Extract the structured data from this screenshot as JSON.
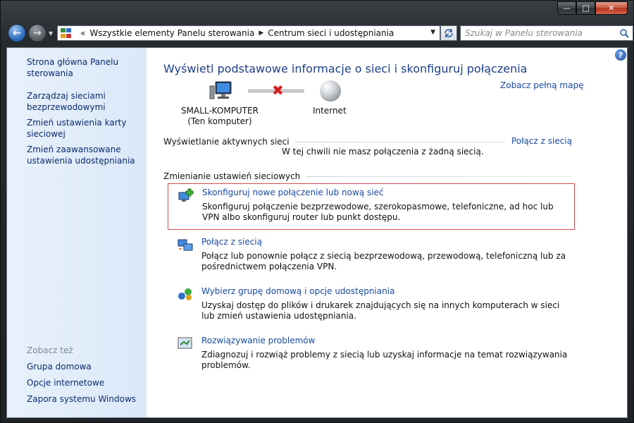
{
  "window": {
    "minimize_glyph": "—",
    "maximize_glyph": "□",
    "close_glyph": "✕"
  },
  "nav": {
    "back_glyph": "←",
    "forward_glyph": "→",
    "breadcrumb_prefix": "«",
    "breadcrumbs": [
      "Wszystkie elementy Panelu sterowania",
      "Centrum sieci i udostępniania"
    ],
    "crumb_separator": "▶",
    "search_placeholder": "Szukaj w Panelu sterowania"
  },
  "sidebar": {
    "links": [
      "Strona główna Panelu sterowania",
      "Zarządzaj sieciami bezprzewodowymi",
      "Zmień ustawienia karty sieciowej",
      "Zmień zaawansowane ustawienia udostępniania"
    ],
    "see_also_label": "Zobacz też",
    "see_also": [
      "Grupa domowa",
      "Opcje internetowe",
      "Zapora systemu Windows"
    ]
  },
  "main": {
    "title": "Wyświetl podstawowe informacje o sieci i skonfiguruj połączenia",
    "full_map_link": "Zobacz pełną mapę",
    "computer_name": "SMALL-KOMPUTER",
    "computer_sub": "(Ten komputer)",
    "internet_label": "Internet",
    "active_section_title": "Wyświetlanie aktywnych sieci",
    "connect_link": "Połącz z siecią",
    "no_connection_text": "W tej chwili nie masz połączenia z żadną siecią.",
    "settings_section_title": "Zmienianie ustawień sieciowych",
    "tasks": [
      {
        "link": "Skonfiguruj nowe połączenie lub nową sieć",
        "desc": "Skonfiguruj połączenie bezprzewodowe, szerokopasmowe, telefoniczne, ad hoc lub VPN albo skonfiguruj router lub punkt dostępu."
      },
      {
        "link": "Połącz z siecią",
        "desc": "Połącz lub ponownie połącz z siecią bezprzewodową, przewodową, telefoniczną lub za pośrednictwem połączenia VPN."
      },
      {
        "link": "Wybierz grupę domową i opcje udostępniania",
        "desc": "Uzyskaj dostęp do plików i drukarek znajdujących się na innych komputerach w sieci lub zmień ustawienia udostępniania."
      },
      {
        "link": "Rozwiązywanie problemów",
        "desc": "Zdiagnozuj i rozwiąż problemy z siecią lub uzyskaj informacje na temat rozwiązywania problemów."
      }
    ],
    "help_glyph": "?"
  },
  "colors": {
    "link": "#1a4aa0",
    "title": "#1e3f8a",
    "highlight_border": "#d44b4b",
    "sidebar_bg": "#dbe8f8"
  }
}
